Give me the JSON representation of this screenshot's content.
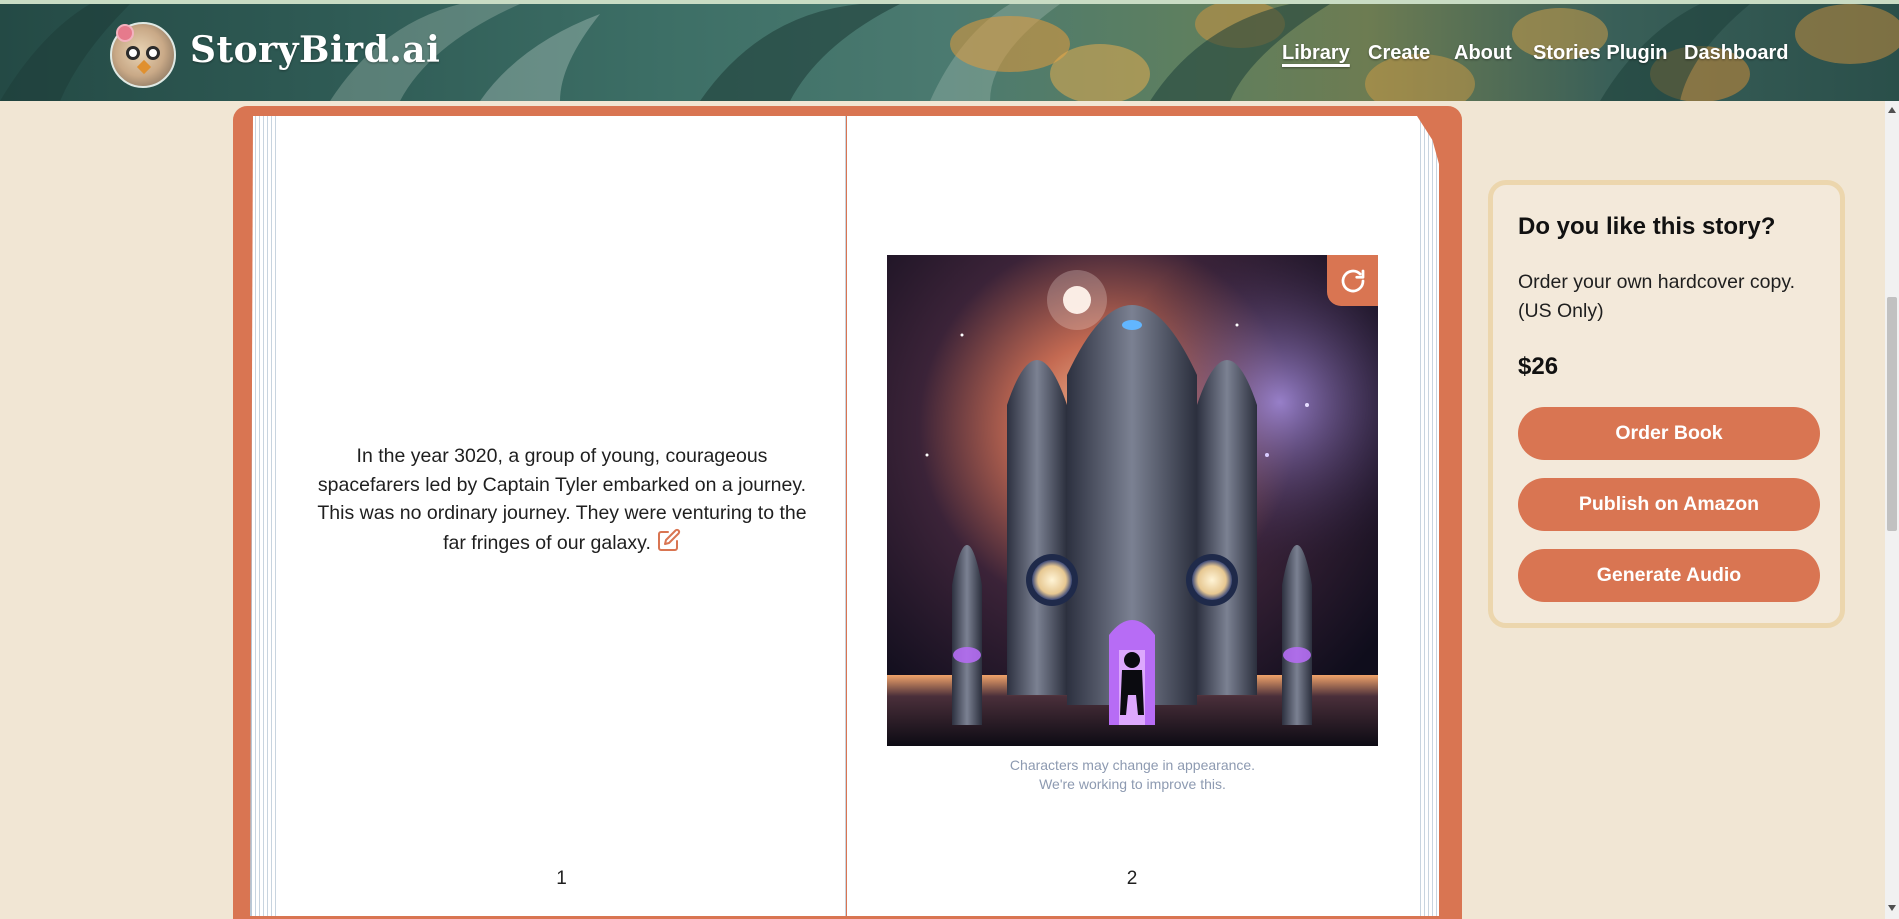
{
  "header": {
    "brand": "StoryBird.ai",
    "nav": [
      {
        "label": "Library",
        "active": true
      },
      {
        "label": "Create",
        "active": false
      },
      {
        "label": "About",
        "active": false
      },
      {
        "label": "Stories Plugin",
        "active": false
      },
      {
        "label": "Dashboard",
        "active": false
      }
    ]
  },
  "book": {
    "left_page": {
      "text": "In the year 3020, a group of young, courageous spacefarers led by Captain Tyler embarked on a journey. This was no ordinary journey. They were venturing to the far fringes of our galaxy.",
      "page_number": "1",
      "icon": "edit-icon"
    },
    "right_page": {
      "illustration_icon": "regenerate-icon",
      "disclaimer_line1": "Characters may change in appearance.",
      "disclaimer_line2": "We're working to improve this.",
      "page_number": "2"
    }
  },
  "order_card": {
    "title": "Do you like this story?",
    "subtitle": "Order your own hardcover copy. (US Only)",
    "price": "$26",
    "buttons": {
      "order": "Order Book",
      "publish": "Publish on Amazon",
      "audio": "Generate Audio"
    }
  },
  "colors": {
    "accent": "#d97552",
    "background": "#f1e6d4",
    "card_border": "#ecd6ad",
    "disclaimer": "#8d9ab1"
  }
}
